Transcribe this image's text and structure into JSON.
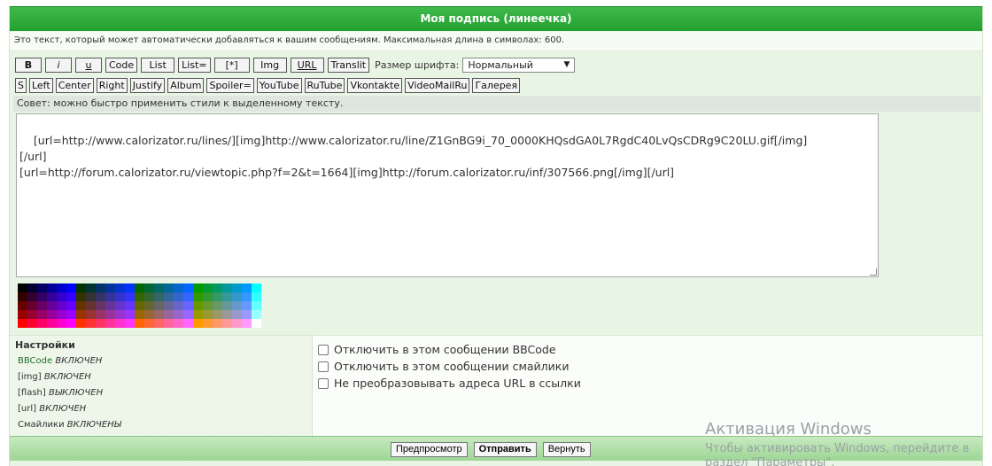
{
  "form": {
    "title": "Моя подпись (линеечка)",
    "description": "Это текст, который может автоматически добавляться к вашим сообщениям. Максимальная длина в символах: 600."
  },
  "toolbar": {
    "row1": [
      "B",
      "i",
      "u",
      "Code",
      "List",
      "List=",
      "[*]",
      "Img",
      "URL",
      "Translit"
    ],
    "font_size_label": "Размер шрифта:",
    "font_size_value": "Нормальный",
    "row2": [
      "S",
      "Left",
      "Center",
      "Right",
      "Justify",
      "Album",
      "Spoiler=",
      "YouTube",
      "RuTube",
      "Vkontakte",
      "VideoMailRu",
      "Галерея"
    ]
  },
  "hint": "Совет: можно быстро применить стили к выделенному тексту.",
  "editor": {
    "value": "[url=http://www.calorizator.ru/lines/][img]http://www.calorizator.ru/line/Z1GnBG9i_70_0000KHQsdGA0L7RgdC40LvQsCDRg9C20LU.gif[/img]\n[/url]\n[url=http://forum.calorizator.ru/viewtopic.php?f=2&t=1664][img]http://forum.calorizator.ru/inf/307566.png[/img][/url]"
  },
  "palette": {
    "rows": [
      [
        "#000000",
        "#000033",
        "#000066",
        "#000099",
        "#0000cc",
        "#0000ff",
        "#003300",
        "#003333",
        "#003366",
        "#003399",
        "#0033cc",
        "#0033ff",
        "#006600",
        "#006633",
        "#006666",
        "#006699",
        "#0066cc",
        "#0066ff",
        "#009900",
        "#009933",
        "#009966",
        "#009999",
        "#0099cc",
        "#0099ff",
        "#00ffff"
      ],
      [
        "#330000",
        "#330033",
        "#330066",
        "#330099",
        "#3300cc",
        "#3300ff",
        "#333300",
        "#333333",
        "#333366",
        "#333399",
        "#3333cc",
        "#3333ff",
        "#336600",
        "#336633",
        "#336666",
        "#336699",
        "#3366cc",
        "#3366ff",
        "#339900",
        "#339933",
        "#339966",
        "#339999",
        "#3399cc",
        "#3399ff",
        "#33ffff"
      ],
      [
        "#660000",
        "#660033",
        "#660066",
        "#660099",
        "#6600cc",
        "#6600ff",
        "#663300",
        "#663333",
        "#663366",
        "#663399",
        "#6633cc",
        "#6633ff",
        "#666600",
        "#666633",
        "#666666",
        "#666699",
        "#6666cc",
        "#6666ff",
        "#669900",
        "#669933",
        "#669966",
        "#669999",
        "#6699cc",
        "#6699ff",
        "#66ffff"
      ],
      [
        "#990000",
        "#990033",
        "#990066",
        "#990099",
        "#9900cc",
        "#9900ff",
        "#993300",
        "#993333",
        "#993366",
        "#993399",
        "#9933cc",
        "#9933ff",
        "#996600",
        "#996633",
        "#996666",
        "#996699",
        "#9966cc",
        "#9966ff",
        "#999900",
        "#999933",
        "#999966",
        "#999999",
        "#9999cc",
        "#9999ff",
        "#99ffff"
      ],
      [
        "#ff0000",
        "#ff0033",
        "#ff0066",
        "#ff0099",
        "#ff00cc",
        "#ff00ff",
        "#ff3300",
        "#ff3333",
        "#ff3366",
        "#ff3399",
        "#ff33cc",
        "#ff33ff",
        "#ff6600",
        "#ff6633",
        "#ff6666",
        "#ff6699",
        "#ff66cc",
        "#ff66ff",
        "#ff9900",
        "#ff9933",
        "#ff9966",
        "#ff9999",
        "#ff99cc",
        "#ff99ff",
        "#ffffff"
      ]
    ]
  },
  "settings": {
    "title": "Настройки",
    "items": [
      {
        "label": "BBCode",
        "state": "ВКЛЮЧЕН"
      },
      {
        "label": "[img]",
        "state": "ВКЛЮЧЕН"
      },
      {
        "label": "[flash]",
        "state": "ВЫКЛЮЧЕН"
      },
      {
        "label": "[url]",
        "state": "ВКЛЮЧЕН"
      },
      {
        "label": "Смайлики",
        "state": "ВКЛЮЧЕНЫ"
      }
    ],
    "options": [
      "Отключить в этом сообщении BBCode",
      "Отключить в этом сообщении смайлики",
      "Не преобразовывать адреса URL в ссылки"
    ]
  },
  "footer": {
    "preview": "Предпросмотр",
    "submit": "Отправить",
    "reset": "Вернуть"
  },
  "watermark": {
    "line1": "Активация Windows",
    "line2": "Чтобы активировать Windows, перейдите в",
    "line3": "раздел \"Параметры\"."
  },
  "colors": {
    "header_green": "#22a030",
    "panel_bg": "#e9f5e4"
  }
}
